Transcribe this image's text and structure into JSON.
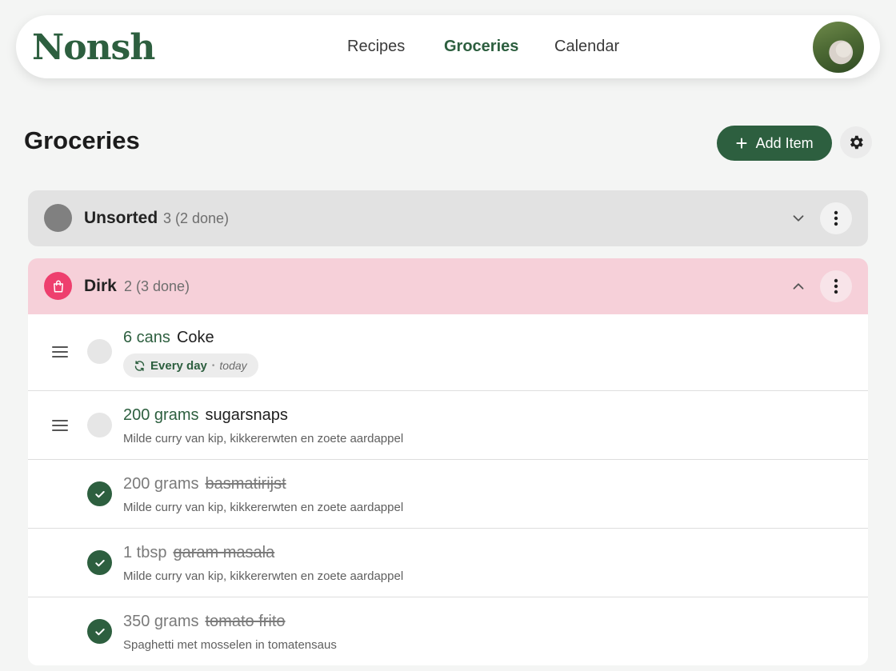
{
  "app": {
    "logo": "Nonsh"
  },
  "nav": {
    "recipes": "Recipes",
    "groceries": "Groceries",
    "calendar": "Calendar"
  },
  "page": {
    "title": "Groceries",
    "add_label": "Add Item"
  },
  "groups": [
    {
      "name": "Unsorted",
      "count": "3 (2 done)",
      "color": "#808080",
      "expanded": false
    },
    {
      "name": "Dirk",
      "count": "2 (3 done)",
      "color": "#ee3f6e",
      "expanded": true
    }
  ],
  "items": [
    {
      "qty": "6 cans",
      "name": "Coke",
      "done": false,
      "recurring": "Every day",
      "when": "today"
    },
    {
      "qty": "200 grams",
      "name": "sugarsnaps",
      "done": false,
      "note": "Milde curry van kip, kikkererwten en zoete aardappel"
    },
    {
      "qty": "200 grams",
      "name": "basmatirijst",
      "done": true,
      "note": "Milde curry van kip, kikkererwten en zoete aardappel"
    },
    {
      "qty": "1 tbsp",
      "name": "garam masala",
      "done": true,
      "note": "Milde curry van kip, kikkererwten en zoete aardappel"
    },
    {
      "qty": "350 grams",
      "name": "tomato frito",
      "done": true,
      "note": "Spaghetti met mosselen in tomatensaus"
    }
  ],
  "colors": {
    "accent": "#2d5f3f",
    "dirk_bg": "#f6d0d9",
    "unsorted_bg": "#e2e2e2"
  }
}
